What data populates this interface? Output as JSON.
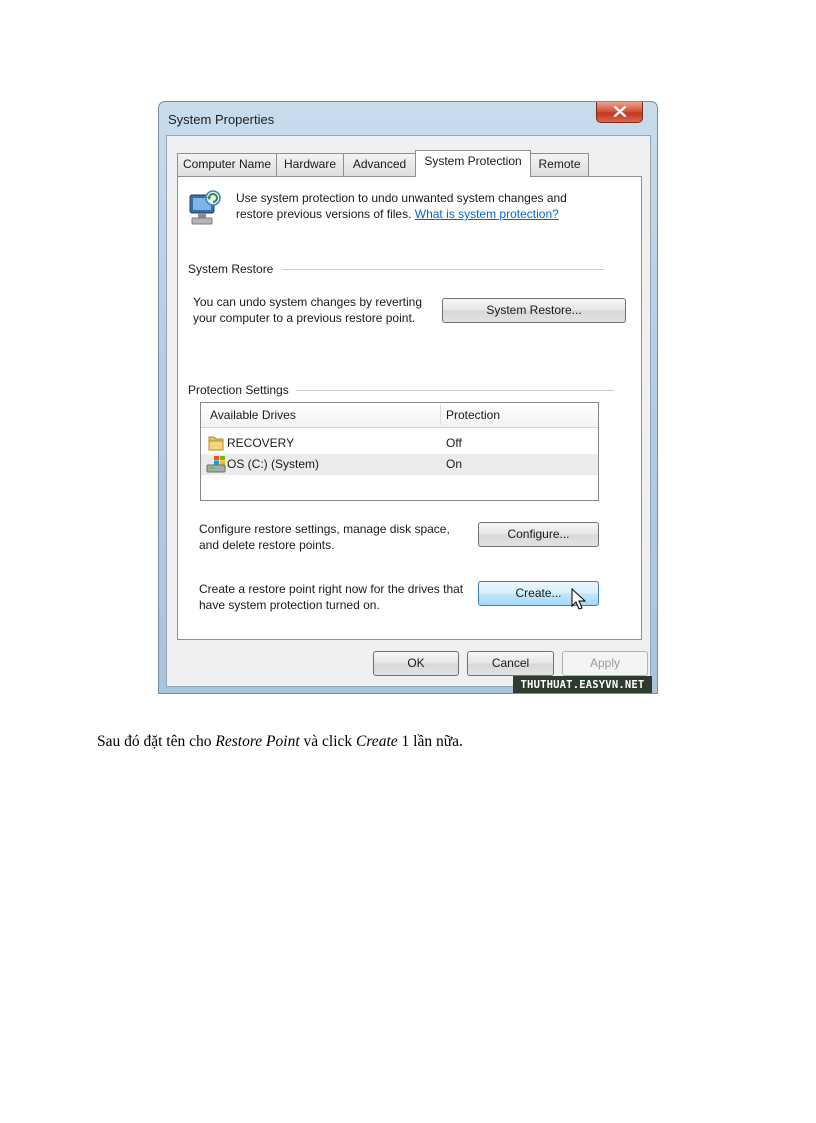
{
  "dialog": {
    "title": "System Properties",
    "tabs": [
      "Computer Name",
      "Hardware",
      "Advanced",
      "System Protection",
      "Remote"
    ],
    "active_tab": "System Protection",
    "intro_line1": "Use system protection to undo unwanted system changes and",
    "intro_line2_text": "restore previous versions of files.",
    "intro_link": "What is system protection?",
    "system_restore": {
      "group_label": "System Restore",
      "desc_line1": "You can undo system changes by reverting",
      "desc_line2": "your computer to a previous restore point.",
      "button": "System Restore..."
    },
    "protection": {
      "group_label": "Protection Settings",
      "columns": [
        "Available Drives",
        "Protection"
      ],
      "drives": [
        {
          "name": "RECOVERY",
          "protection": "Off",
          "icon": "folder-icon"
        },
        {
          "name": "OS (C:) (System)",
          "protection": "On",
          "icon": "system-drive-icon"
        }
      ],
      "configure_line1": "Configure restore settings, manage disk space,",
      "configure_line2": "and delete restore points.",
      "configure_button": "Configure...",
      "create_line1": "Create a restore point right now for the drives that",
      "create_line2": "have system protection turned on.",
      "create_button": "Create..."
    },
    "footer": {
      "ok": "OK",
      "cancel": "Cancel",
      "apply": "Apply"
    },
    "watermark": "THUTHUAT.EASYVN.NET"
  },
  "caption": {
    "part1": "Sau đó đặt tên cho ",
    "italic1": "Restore Point",
    "part2": " và click ",
    "italic2": "Create",
    "part3": " 1 lần nữa."
  }
}
